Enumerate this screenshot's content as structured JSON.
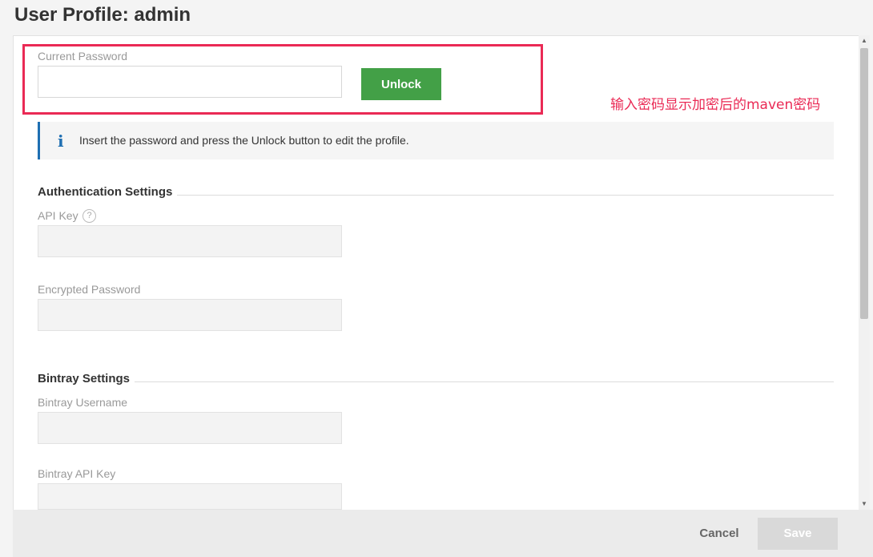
{
  "header": {
    "title": "User Profile: admin"
  },
  "unlock": {
    "current_password_label": "Current Password",
    "current_password_value": "",
    "unlock_label": "Unlock"
  },
  "annotation": {
    "text": "输入密码显示加密后的maven密码",
    "color": "#ea2a55"
  },
  "info": {
    "icon": "info-icon",
    "text": "Insert the password and press the Unlock button to edit the profile."
  },
  "authentication": {
    "title": "Authentication Settings",
    "api_key_label": "API Key",
    "api_key_value": "",
    "encrypted_password_label": "Encrypted Password",
    "encrypted_password_value": ""
  },
  "bintray": {
    "title": "Bintray Settings",
    "username_label": "Bintray Username",
    "username_value": "",
    "api_key_label": "Bintray API Key",
    "api_key_value": ""
  },
  "footer": {
    "cancel_label": "Cancel",
    "save_label": "Save"
  },
  "colors": {
    "accent_green": "#43a047",
    "info_blue": "#1f6fb2",
    "highlight_red": "#ea2a55"
  }
}
